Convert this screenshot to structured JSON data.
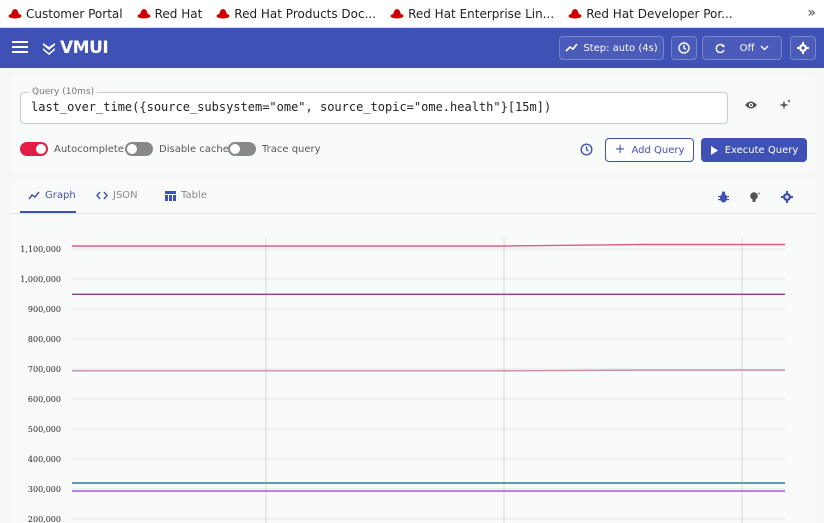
{
  "bookmarks": {
    "items": [
      {
        "label": "Customer Portal",
        "icon": "redhat-icon"
      },
      {
        "label": "Red Hat",
        "icon": "redhat-icon"
      },
      {
        "label": "Red Hat Products Doc...",
        "icon": "redhat-icon"
      },
      {
        "label": "Red Hat Enterprise Lin...",
        "icon": "redhat-icon"
      },
      {
        "label": "Red Hat Developer Por...",
        "icon": "redhat-icon"
      }
    ],
    "more_icon": "chevron-double-right-icon",
    "more_label": "»"
  },
  "header": {
    "logo_text": "VMUI",
    "step_label": "Step: auto (4s)",
    "refresh_label": "Off",
    "accent_color": "#3f51b5"
  },
  "query": {
    "legend": "Query (10ms)",
    "expression": "last_over_time({source_subsystem=\"ome\", source_topic=\"ome.health\"}[15m])",
    "autocomplete_label": "Autocomplete",
    "disable_cache_label": "Disable cache",
    "trace_query_label": "Trace query",
    "add_query_label": "Add Query",
    "execute_query_label": "Execute Query"
  },
  "tabs": {
    "graph": "Graph",
    "json": "JSON",
    "table": "Table"
  },
  "chart_data": {
    "type": "line",
    "y_ticks": [
      "1,100,000",
      "1,000,000",
      "900,000",
      "800,000",
      "700,000",
      "600,000",
      "500,000",
      "400,000",
      "300,000",
      "200,000"
    ],
    "ylim": [
      200000,
      1150000
    ],
    "series": [
      {
        "color": "#e05a7a",
        "values": [
          1110000,
          1110000,
          1110000,
          1110000,
          1115000,
          1115000
        ]
      },
      {
        "color": "#8e3d8e",
        "values": [
          949000,
          949000,
          949000,
          949000,
          949000,
          949000
        ]
      },
      {
        "color": "#c98ab0",
        "values": [
          694000,
          694000,
          694000,
          694000,
          696000,
          696000
        ]
      },
      {
        "color": "#2e7d8c",
        "values": [
          320000,
          320000,
          320000,
          320000,
          320000,
          320000
        ]
      },
      {
        "color": "#9b4de0",
        "values": [
          293000,
          293000,
          293000,
          293000,
          293000,
          293000
        ]
      }
    ],
    "grid": true
  }
}
